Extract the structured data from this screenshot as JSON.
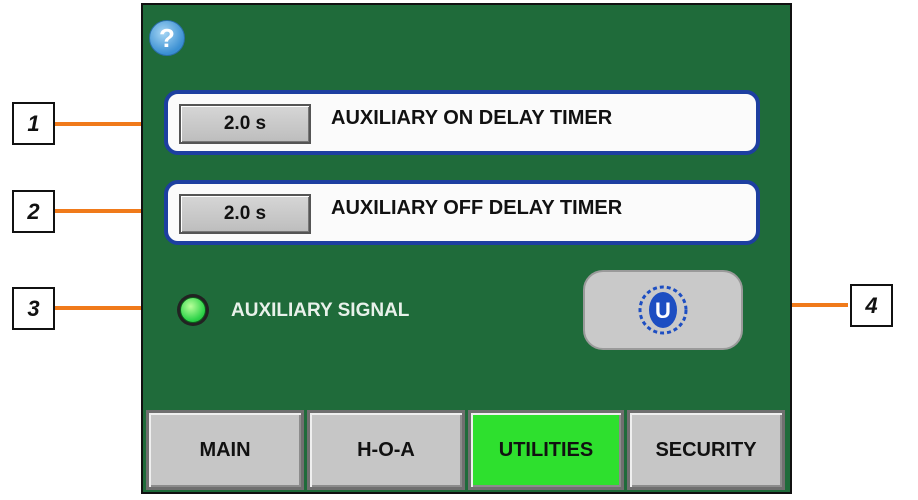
{
  "help": {
    "icon": "question-mark-icon",
    "glyph": "?"
  },
  "timers": [
    {
      "value": "2.0 s",
      "label": "AUXILIARY ON DELAY TIMER"
    },
    {
      "value": "2.0 s",
      "label": "AUXILIARY OFF DELAY TIMER"
    }
  ],
  "signal": {
    "label": "AUXILIARY SIGNAL",
    "indicator_color": "#2fd44a",
    "state": "on"
  },
  "utility_button": {
    "icon": "u-logo-icon",
    "glyph": "U"
  },
  "nav": [
    {
      "label": "MAIN",
      "active": false
    },
    {
      "label": "H-O-A",
      "active": false
    },
    {
      "label": "UTILITIES",
      "active": true
    },
    {
      "label": "SECURITY",
      "active": false
    }
  ],
  "callouts": [
    "1",
    "2",
    "3",
    "4"
  ],
  "colors": {
    "panel_bg": "#1f6b3a",
    "row_border": "#1d3fa0",
    "active_tab": "#2ee02e",
    "arrow": "#f07a1a"
  }
}
